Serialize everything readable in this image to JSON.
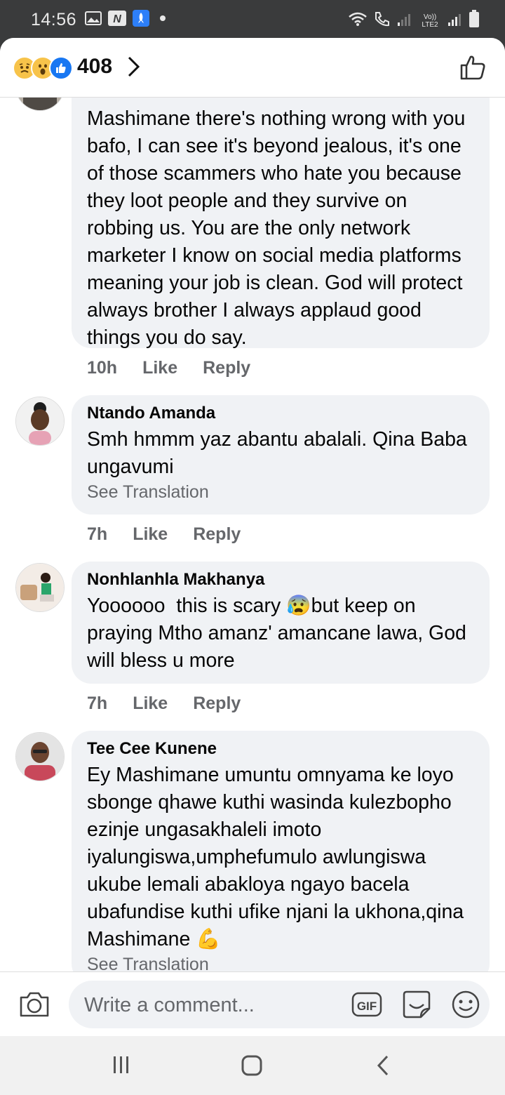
{
  "status_bar": {
    "time": "14:56",
    "network": "LTE2",
    "carrier_label": "Vo)) LTE2"
  },
  "header": {
    "reaction_count": "408"
  },
  "comments": [
    {
      "name": "",
      "text": "Mashimane there's nothing wrong with you bafo, I can see it's beyond jealous, it's one of those scammers who hate you because they loot people and they survive on robbing us. You are the only network marketer I know on social media platforms meaning your job is clean. God will protect always brother I always applaud good things you do say.",
      "time": "10h",
      "like": "Like",
      "reply": "Reply"
    },
    {
      "name": "Ntando Amanda",
      "text": "Smh hmmm yaz abantu abalali. Qina Baba ungavumi",
      "see_translation": "See Translation",
      "time": "7h",
      "like": "Like",
      "reply": "Reply"
    },
    {
      "name": "Nonhlanhla Makhanya",
      "text": "Yoooooo  this is scary 😰but keep on praying Mtho amanz' amancane lawa, God will bless u more",
      "time": "7h",
      "like": "Like",
      "reply": "Reply"
    },
    {
      "name": "Tee Cee Kunene",
      "text": "Ey Mashimane umuntu omnyama ke loyo sbonge qhawe kuthi wasinda kulezbopho ezinje ungasakhaleli imoto iyalungiswa,umphefumulo awlungiswa ukube lemali abakloya ngayo bacela ubafundise kuthi ufike njani la ukhona,qina Mashimane 💪",
      "see_translation": "See Translation"
    }
  ],
  "composer": {
    "placeholder": "Write a comment...",
    "gif_label": "GIF"
  },
  "colors": {
    "bubble": "#f0f2f5",
    "meta": "#65676b",
    "like_blue": "#1877f2",
    "statusbar": "#3a3b3c"
  }
}
